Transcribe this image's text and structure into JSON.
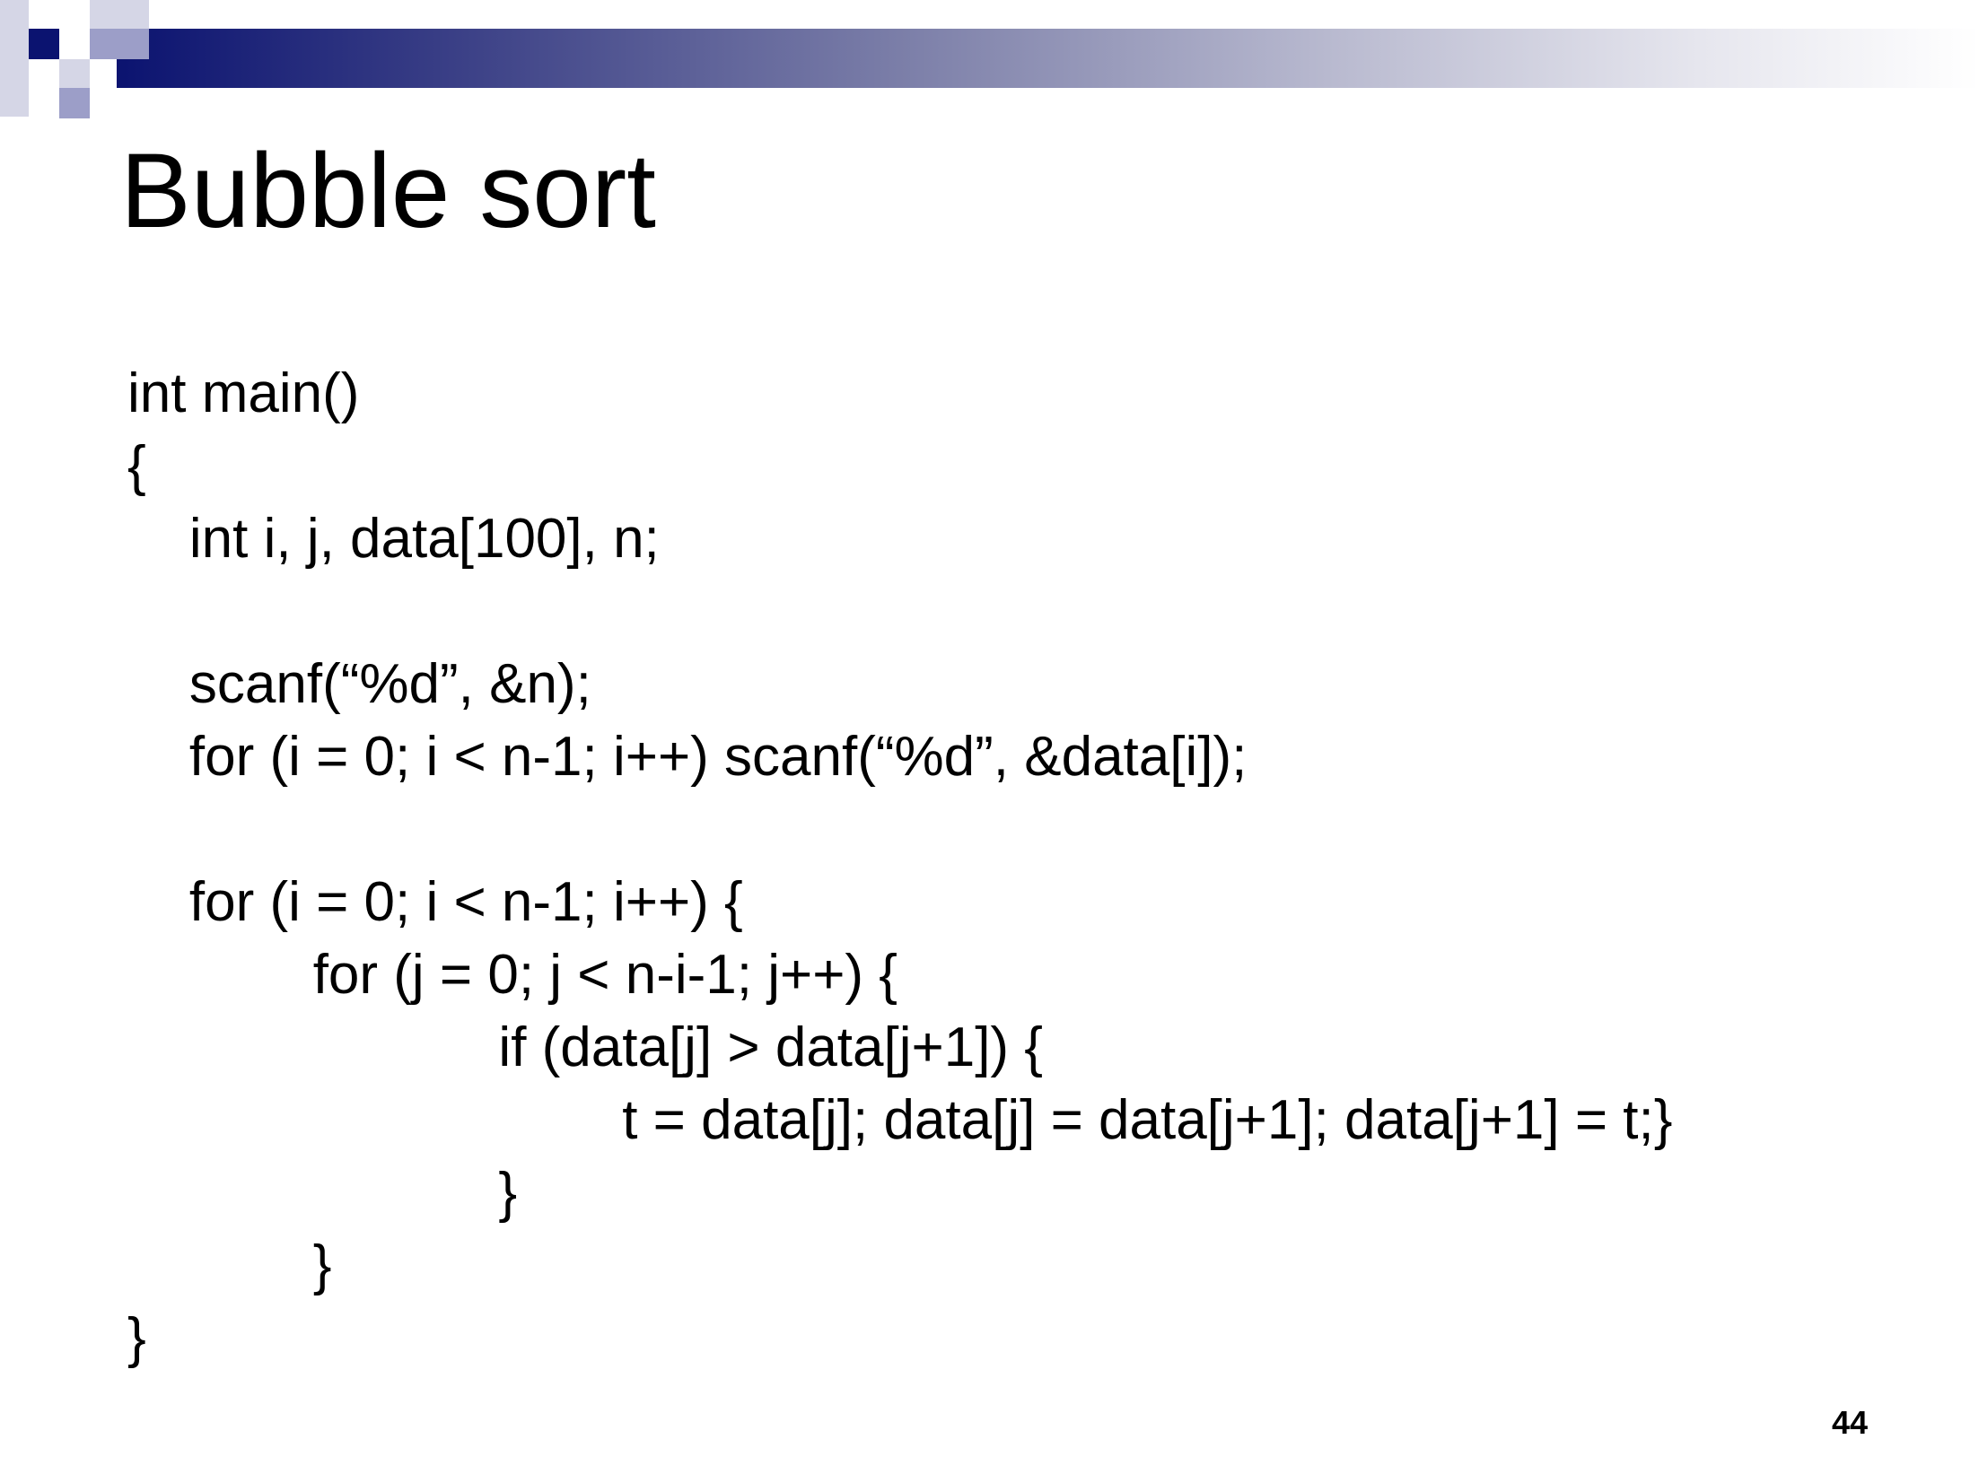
{
  "slide": {
    "title": "Bubble sort",
    "page_number": "44",
    "colors": {
      "accent_dark": "#0b1370",
      "accent_mid": "#9c9ec8",
      "accent_light": "#d5d6e6"
    }
  },
  "code": {
    "lines": [
      "int main()",
      "{",
      "    int i, j, data[100], n;",
      "",
      "    scanf(“%d”, &n);",
      "    for (i = 0; i < n-1; i++) scanf(“%d”, &data[i]);",
      "",
      "    for (i = 0; i < n-1; i++) {",
      "            for (j = 0; j < n-i-1; j++) {",
      "                        if (data[j] > data[j+1]) {",
      "                                t = data[j]; data[j] = data[j+1]; data[j+1] = t;}",
      "                        }",
      "            }",
      "}"
    ]
  }
}
